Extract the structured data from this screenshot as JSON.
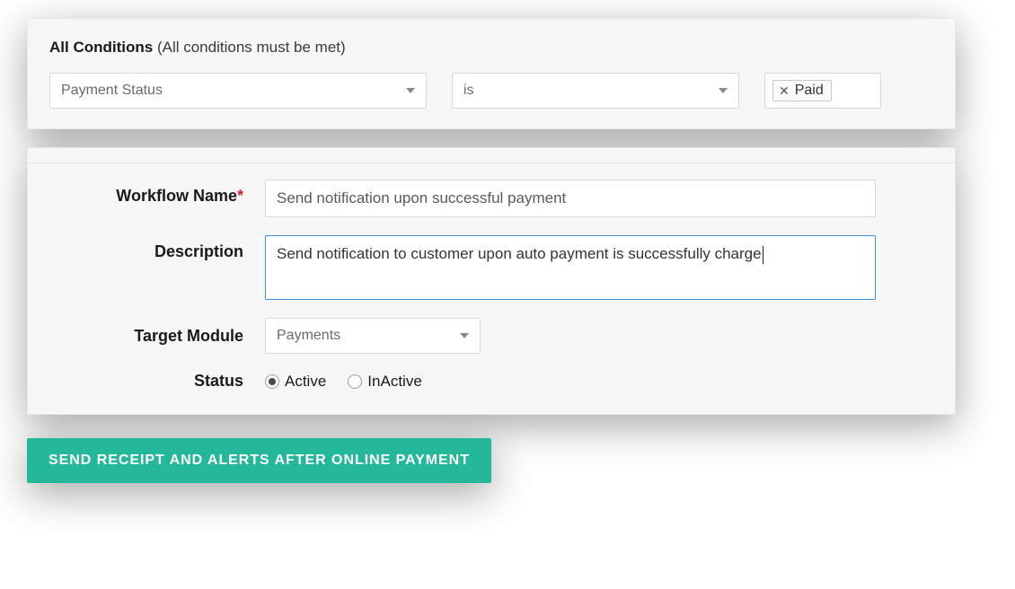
{
  "conditions": {
    "heading_strong": "All Conditions",
    "heading_hint": " (All conditions must be met)",
    "field_select": "Payment Status",
    "operator_select": "is",
    "value_chip": "Paid"
  },
  "form": {
    "workflow_name_label": "Workflow Name",
    "workflow_name_required": "*",
    "workflow_name_value": "Send notification upon successful payment",
    "description_label": "Description",
    "description_value": "Send notification to customer upon auto payment is successfully charge",
    "target_module_label": "Target Module",
    "target_module_value": "Payments",
    "status_label": "Status",
    "status_active": "Active",
    "status_inactive": "InActive",
    "status_selected": "Active"
  },
  "cta_label": "Send receipt and alerts after online payment"
}
